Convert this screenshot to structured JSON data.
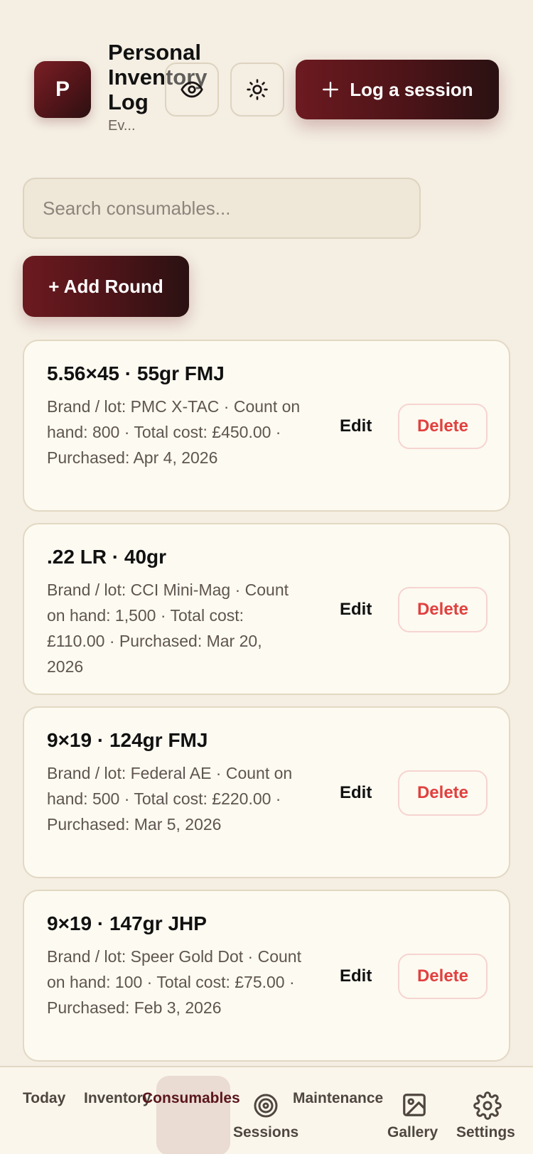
{
  "header": {
    "logo_letter": "P",
    "title": "Personal Inventory Log",
    "subtitle": "Ev...",
    "log_button_label": "Log a session",
    "log_button_icon": "plus-icon"
  },
  "search": {
    "placeholder": "Search consumables..."
  },
  "add_button_label": "+ Add Round",
  "consumables": [
    {
      "title": "5.56×45 · 55gr FMJ",
      "meta": "Brand / lot: PMC X-TAC · Count on hand: 800 · Total cost: £450.00 · Purchased: Apr 4, 2026",
      "edit_label": "Edit",
      "delete_label": "Delete"
    },
    {
      "title": ".22 LR · 40gr",
      "meta": "Brand / lot: CCI Mini-Mag · Count on hand: 1,500 · Total cost: £110.00 · Purchased: Mar 20, 2026",
      "edit_label": "Edit",
      "delete_label": "Delete"
    },
    {
      "title": "9×19 · 124gr FMJ",
      "meta": "Brand / lot: Federal AE · Count on hand: 500 · Total cost: £220.00 · Purchased: Mar 5, 2026",
      "edit_label": "Edit",
      "delete_label": "Delete"
    },
    {
      "title": "9×19 · 147gr JHP",
      "meta": "Brand / lot: Speer Gold Dot · Count on hand: 100 · Total cost: £75.00 · Purchased: Feb 3, 2026",
      "edit_label": "Edit",
      "delete_label": "Delete"
    }
  ],
  "nav": {
    "today": "Today",
    "inventory": "Inventory",
    "consumables": "Consumables",
    "sessions": "Sessions",
    "maintenance": "Maintenance",
    "gallery": "Gallery",
    "settings": "Settings",
    "active": "consumables"
  },
  "colors": {
    "accent": "#5a161b",
    "background": "#f4eee3",
    "card": "#fdfaf1",
    "delete": "#e0413f"
  }
}
